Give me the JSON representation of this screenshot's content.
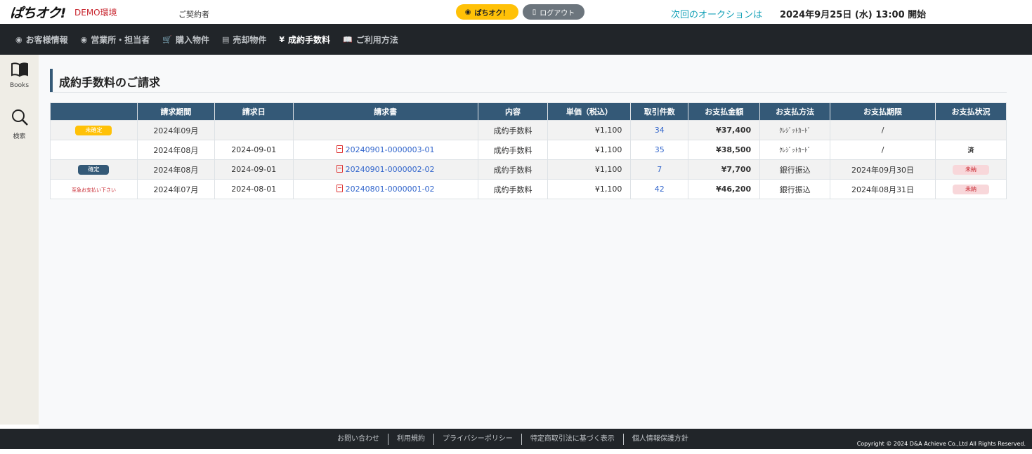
{
  "header": {
    "logo": "ぱちオク!",
    "demo_label": "DEMO環境",
    "contractor_label": "ご契約者",
    "pachi_button": "ぱちオク！",
    "logout_button": "ログアウト",
    "next_auction_label": "次回のオークションは",
    "next_auction_date": "2024年9月25日 (水) 13:00 開始"
  },
  "nav": {
    "items": [
      {
        "label": "お客様情報",
        "icon": "user-circle-icon",
        "glyph": "◉"
      },
      {
        "label": "営業所・担当者",
        "icon": "user-circle-icon",
        "glyph": "◉"
      },
      {
        "label": "購入物件",
        "icon": "cart-icon",
        "glyph": "🛒"
      },
      {
        "label": "売却物件",
        "icon": "archive-icon",
        "glyph": "▤"
      },
      {
        "label": "成約手数料",
        "icon": "yen-icon",
        "glyph": "¥"
      },
      {
        "label": "ご利用方法",
        "icon": "book-icon",
        "glyph": "📖"
      }
    ],
    "active_index": 4
  },
  "sidebar": {
    "books_label": "Books",
    "search_label": "検索"
  },
  "main": {
    "title": "成約手数料のご請求",
    "table": {
      "headers": [
        "",
        "請求期間",
        "請求日",
        "請求書",
        "内容",
        "単価（税込）",
        "取引件数",
        "お支払金額",
        "お支払方法",
        "お支払期限",
        "お支払状況"
      ],
      "rows": [
        {
          "status": "未確定",
          "period": "2024年09月",
          "date": "",
          "invoice": "",
          "content": "成約手数料",
          "unit_price": "¥1,100",
          "count": "34",
          "amount": "¥37,400",
          "method": "ｸﾚｼﾞｯﾄｶｰﾄﾞ",
          "deadline": "/",
          "payment_status": ""
        },
        {
          "status": "",
          "period": "2024年08月",
          "date": "2024-09-01",
          "invoice": "20240901-0000003-01",
          "content": "成約手数料",
          "unit_price": "¥1,100",
          "count": "35",
          "amount": "¥38,500",
          "method": "ｸﾚｼﾞｯﾄｶｰﾄﾞ",
          "deadline": "/",
          "payment_status": "済"
        },
        {
          "status": "確定",
          "period": "2024年08月",
          "date": "2024-09-01",
          "invoice": "20240901-0000002-02",
          "content": "成約手数料",
          "unit_price": "¥1,100",
          "count": "7",
          "amount": "¥7,700",
          "method": "銀行振込",
          "deadline": "2024年09月30日",
          "payment_status": "未納"
        },
        {
          "status": "至急お支払い下さい",
          "period": "2024年07月",
          "date": "2024-08-01",
          "invoice": "20240801-0000001-02",
          "content": "成約手数料",
          "unit_price": "¥1,100",
          "count": "42",
          "amount": "¥46,200",
          "method": "銀行振込",
          "deadline": "2024年08月31日",
          "payment_status": "未納"
        }
      ]
    }
  },
  "footer": {
    "links": [
      "お問い合わせ",
      "利用規約",
      "プライバシーポリシー",
      "特定商取引法に基づく表示",
      "個人情報保護方針"
    ],
    "copyright": "Copyright © 2024 D&A Achieve Co.,Ltd All Rights Reserved."
  },
  "colors": {
    "header_bg": "#ffffff",
    "nav_bg": "#212529",
    "table_header": "#345977",
    "accent_yellow": "#ffc107",
    "accent_cyan": "#17a2b8",
    "danger": "#c8262f",
    "link": "#3366cc"
  }
}
